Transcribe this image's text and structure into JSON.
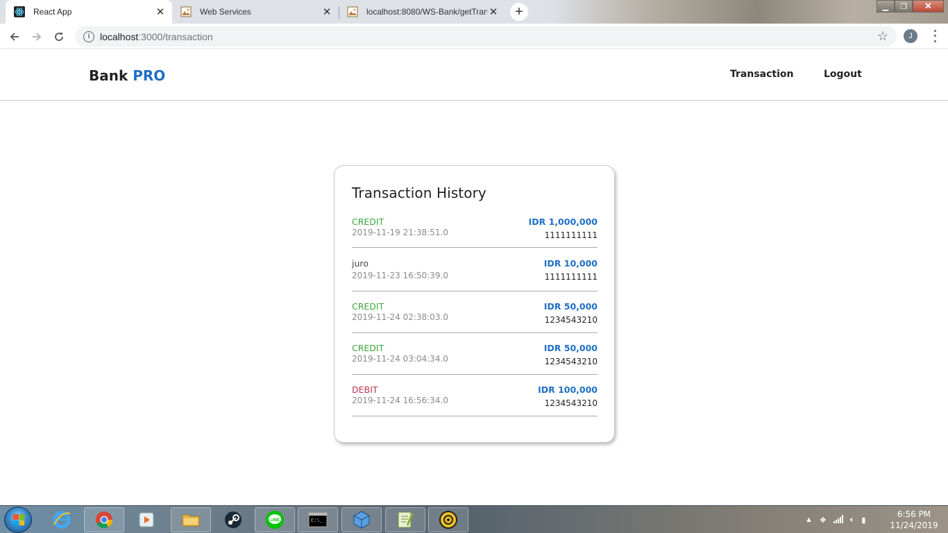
{
  "browser": {
    "tabs": [
      {
        "label": "React App",
        "icon": "react-icon",
        "active": true
      },
      {
        "label": "Web Services",
        "icon": "image-icon",
        "active": false
      },
      {
        "label": "localhost:8080/WS-Bank/getTran",
        "icon": "image-icon",
        "active": false
      }
    ],
    "url_host": "localhost",
    "url_path": ":3000/transaction",
    "profile_initial": "J"
  },
  "app": {
    "brand_main": "Bank",
    "brand_accent": "PRO",
    "nav": {
      "transaction": "Transaction",
      "logout": "Logout"
    },
    "history_title": "Transaction History",
    "transactions": [
      {
        "type": "CREDIT",
        "date": "2019-11-19 21:38:51.0",
        "amount": "IDR 1,000,000",
        "account": "1111111111",
        "kind": "credit"
      },
      {
        "type": "juro",
        "date": "2019-11-23 16:50:39.0",
        "amount": "IDR 10,000",
        "account": "1111111111",
        "kind": "neutral"
      },
      {
        "type": "CREDIT",
        "date": "2019-11-24 02:38:03.0",
        "amount": "IDR 50,000",
        "account": "1234543210",
        "kind": "credit"
      },
      {
        "type": "CREDIT",
        "date": "2019-11-24 03:04:34.0",
        "amount": "IDR 50,000",
        "account": "1234543210",
        "kind": "credit"
      },
      {
        "type": "DEBIT",
        "date": "2019-11-24 16:56:34.0",
        "amount": "IDR 100,000",
        "account": "1234543210",
        "kind": "debit"
      }
    ],
    "colors": {
      "brand_accent": "#1f6fc4",
      "credit": "#3aa63a",
      "debit": "#c0334d"
    }
  },
  "taskbar": {
    "time": "6:56 PM",
    "date": "11/24/2019",
    "apps": [
      "internet-explorer-icon",
      "chrome-icon",
      "media-player-icon",
      "file-explorer-icon",
      "steam-icon",
      "line-icon",
      "cmd-icon",
      "virtualbox-icon",
      "notepad-plus-icon",
      "settings-app-icon"
    ]
  }
}
